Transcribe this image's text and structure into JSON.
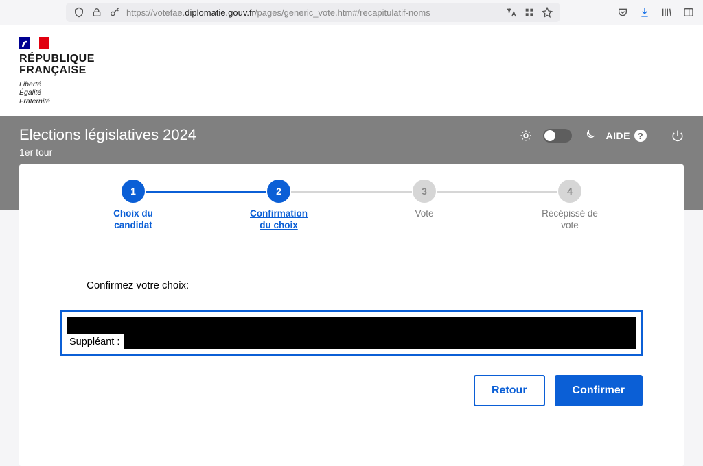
{
  "url": {
    "prefix": "https://votefae.",
    "host": "diplomatie.gouv.fr",
    "suffix": "/pages/generic_vote.htm#/recapitulatif-noms"
  },
  "brand": {
    "title_line1": "RÉPUBLIQUE",
    "title_line2": "FRANÇAISE",
    "motto_line1": "Liberté",
    "motto_line2": "Égalité",
    "motto_line3": "Fraternité"
  },
  "titlebar": {
    "election_title": "Elections législatives 2024",
    "round": "1er tour",
    "help_label": "AIDE"
  },
  "stepper": {
    "steps": [
      {
        "num": "1",
        "label_line1": "Choix du",
        "label_line2": "candidat",
        "state": "done"
      },
      {
        "num": "2",
        "label_line1": "Confirmation",
        "label_line2": "du choix",
        "state": "active"
      },
      {
        "num": "3",
        "label_line1": "Vote",
        "label_line2": "",
        "state": "pending"
      },
      {
        "num": "4",
        "label_line1": "Récépissé de",
        "label_line2": "vote",
        "state": "pending"
      }
    ]
  },
  "confirm": {
    "prompt": "Confirmez votre choix:",
    "suppleant_label": "Suppléant :"
  },
  "buttons": {
    "back": "Retour",
    "confirm": "Confirmer"
  }
}
